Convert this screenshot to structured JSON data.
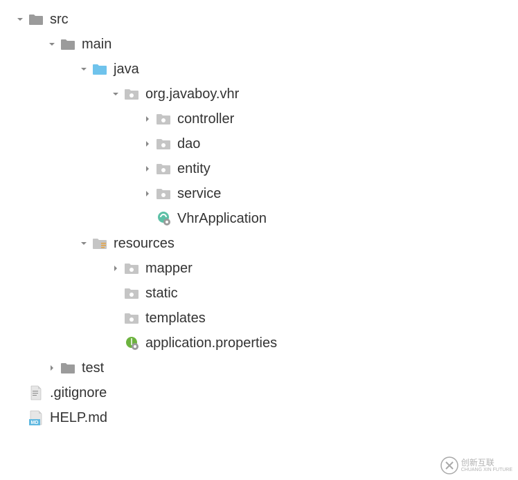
{
  "tree": {
    "src": "src",
    "main": "main",
    "java": "java",
    "package": "org.javaboy.vhr",
    "controller": "controller",
    "dao": "dao",
    "entity": "entity",
    "service": "service",
    "app": "VhrApplication",
    "resources": "resources",
    "mapper": "mapper",
    "static": "static",
    "templates": "templates",
    "appprops": "application.properties",
    "test": "test",
    "gitignore": ".gitignore",
    "help": "HELP.md"
  },
  "watermark": {
    "line1": "创新互联",
    "line2": "CHUANG XIN FUTURE"
  }
}
